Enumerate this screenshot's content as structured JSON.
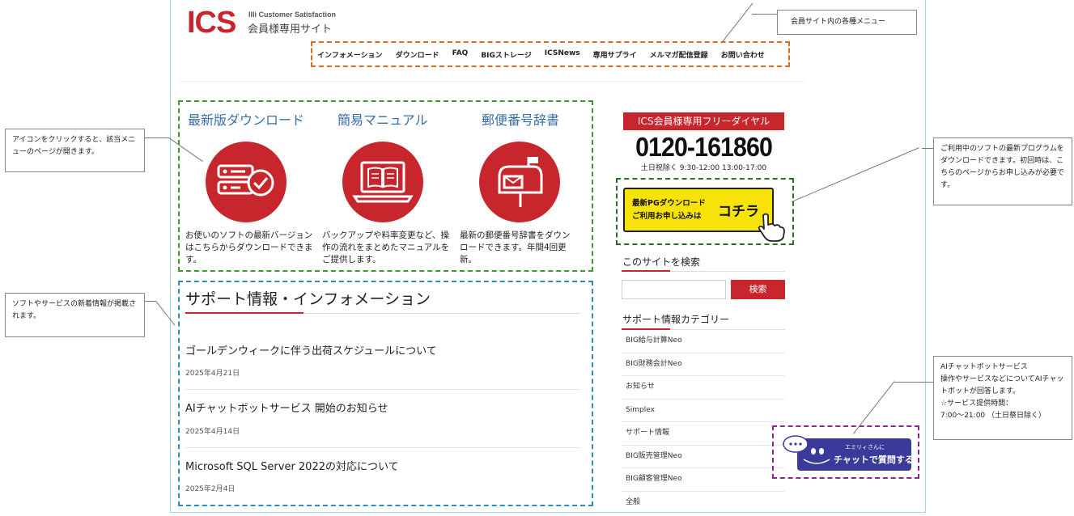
{
  "header": {
    "logo_text": "ICS",
    "logo_subtitle": "Illi Customer Satisfaction",
    "site_name": "会員様専用サイト"
  },
  "nav": {
    "items": [
      "インフォメーション",
      "ダウンロード",
      "FAQ",
      "BIGストレージ",
      "ICSNews",
      "専用サプライ",
      "メルマガ配信登録",
      "お問い合わせ"
    ]
  },
  "features": [
    {
      "title": "最新版ダウンロード",
      "icon": "server-check-icon",
      "desc": "お使いのソフトの最新バージョンはこちらからダウンロードできます。"
    },
    {
      "title": "簡易マニュアル",
      "icon": "laptop-manual-icon",
      "desc": "バックアップや料率変更など、操作の流れをまとめたマニュアルをご提供します。"
    },
    {
      "title": "郵便番号辞書",
      "icon": "mailbox-icon",
      "desc": "最新の郵便番号辞書をダウンロードできます。年間4回更新。"
    }
  ],
  "support": {
    "title": "サポート情報・インフォメーション",
    "news": [
      {
        "title": "ゴールデンウィークに伴う出荷スケジュールについて",
        "date": "2025年4月21日"
      },
      {
        "title": "AIチャットボットサービス 開始のお知らせ",
        "date": "2025年4月14日"
      },
      {
        "title": "Microsoft SQL Server 2022の対応について",
        "date": "2025年2月4日"
      }
    ]
  },
  "sidebar": {
    "dial_header": "ICS会員様専用フリーダイヤル",
    "dial_number": "0120-161860",
    "dial_hours": "土日祝除く 9:30-12:00 13:00-17:00",
    "pg_line1": "最新PGダウンロード",
    "pg_line2": "ご利用お申し込みは",
    "pg_kochira": "コチラ",
    "search_heading": "このサイトを検索",
    "search_placeholder": "",
    "search_button": "検索",
    "category_heading": "サポート情報カテゴリー",
    "categories": [
      "BIG給与計算Neo",
      "BIG財務会計Neo",
      "お知らせ",
      "Simplex",
      "サポート情報",
      "BIG販売管理Neo",
      "BIG顧客管理Neo",
      "全般"
    ]
  },
  "chatbot": {
    "small_text": "エミリィさんに",
    "big_text": "チャットで質問する"
  },
  "callouts": {
    "menu": "会員サイト内の各種メニュー",
    "icons": "アイコンをクリックすると、該当メニューのページが開きます。",
    "news": "ソフトやサービスの新着情報が掲載されます。",
    "pg": "ご利用中のソフトの最新プログラムをダウンロードできます。初回時は、こちらのページからお申し込みが必要です。",
    "ai": [
      "AIチャットボットサービス",
      "操作やサービスなどについてAIチャットボットが回答します。",
      "☆サービス提供時間：",
      "7:00～21:00 （土日祭日除く）"
    ]
  },
  "colors": {
    "brand_red": "#c7262c",
    "link_blue": "#3a6ea8",
    "chat_purple": "#3a3a9a",
    "banner_yellow": "#f7e20a"
  }
}
